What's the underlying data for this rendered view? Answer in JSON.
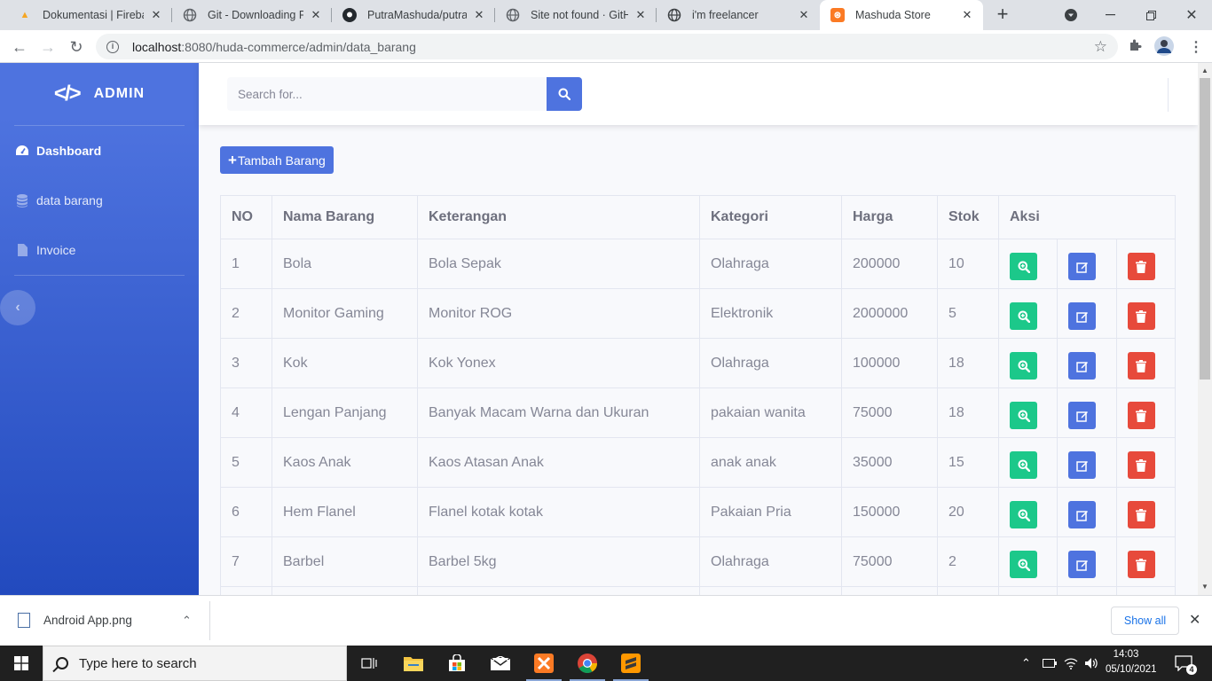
{
  "browser": {
    "tabs": [
      {
        "title": "Dokumentasi  |  Fireba",
        "icon": "firebase-icon",
        "color": "#f5a623"
      },
      {
        "title": "Git - Downloading Pac",
        "icon": "globe-icon",
        "color": "#5f6368"
      },
      {
        "title": "PutraMashuda/putram",
        "icon": "github-icon",
        "color": "#24292e"
      },
      {
        "title": "Site not found · GitHu",
        "icon": "globe-icon",
        "color": "#5f6368"
      },
      {
        "title": "i'm freelancer",
        "icon": "globe-icon",
        "color": "#5f6368"
      },
      {
        "title": "Mashuda Store",
        "icon": "xampp-icon",
        "color": "#fb7a24"
      }
    ],
    "url_host": "localhost",
    "url_path": ":8080/huda-commerce/admin/data_barang"
  },
  "sidebar": {
    "brand": "ADMIN",
    "items": [
      {
        "label": "Dashboard",
        "icon": "tachometer-icon"
      },
      {
        "label": "data barang",
        "icon": "database-icon"
      },
      {
        "label": "Invoice",
        "icon": "file-icon"
      }
    ]
  },
  "topbar": {
    "search_placeholder": "Search for..."
  },
  "main": {
    "add_button": "Tambah Barang",
    "table": {
      "headers": [
        "NO",
        "Nama Barang",
        "Keterangan",
        "Kategori",
        "Harga",
        "Stok",
        "Aksi"
      ],
      "rows": [
        [
          "1",
          "Bola",
          "Bola Sepak",
          "Olahraga",
          "200000",
          "10"
        ],
        [
          "2",
          "Monitor Gaming",
          "Monitor ROG",
          "Elektronik",
          "2000000",
          "5"
        ],
        [
          "3",
          "Kok",
          "Kok Yonex",
          "Olahraga",
          "100000",
          "18"
        ],
        [
          "4",
          "Lengan Panjang",
          "Banyak Macam Warna dan Ukuran",
          "pakaian wanita",
          "75000",
          "18"
        ],
        [
          "5",
          "Kaos Anak",
          "Kaos Atasan Anak",
          "anak anak",
          "35000",
          "15"
        ],
        [
          "6",
          "Hem Flanel",
          "Flanel kotak kotak",
          "Pakaian Pria",
          "150000",
          "20"
        ],
        [
          "7",
          "Barbel",
          "Barbel 5kg",
          "Olahraga",
          "75000",
          "2"
        ]
      ]
    }
  },
  "download_bar": {
    "file": "Android App.png",
    "show_all": "Show all"
  },
  "taskbar": {
    "search_text": "Type here to search",
    "time": "14:03",
    "date": "05/10/2021",
    "notification_count": "4"
  },
  "colors": {
    "primary": "#4e73df",
    "success": "#1cc88a",
    "danger": "#e74a3b"
  }
}
